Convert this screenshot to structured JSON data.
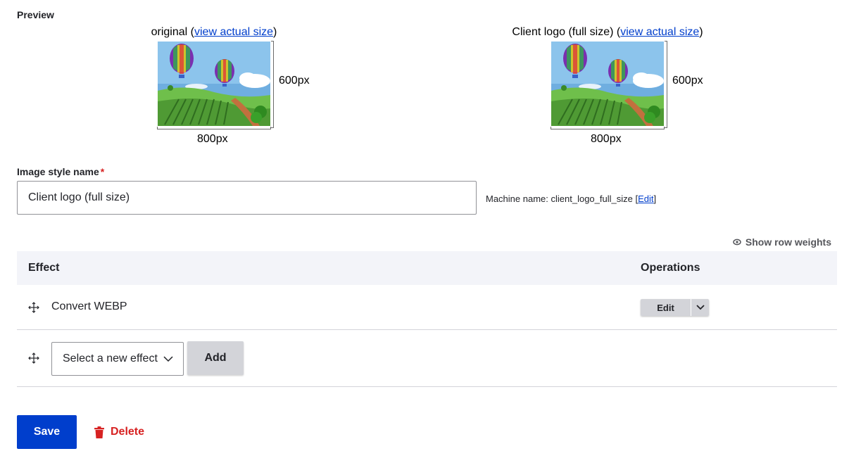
{
  "preview": {
    "section_label": "Preview",
    "original": {
      "caption": "original",
      "link": "view actual size",
      "height_label": "600px",
      "width_label": "800px"
    },
    "styled": {
      "caption": "Client logo (full size)",
      "link": "view actual size",
      "height_label": "600px",
      "width_label": "800px"
    }
  },
  "name_field": {
    "label": "Image style name",
    "required_marker": "*",
    "value": "Client logo (full size)",
    "machine_name_prefix": "Machine name: client_logo_full_size [",
    "machine_name_edit": "Edit",
    "machine_name_suffix": "]"
  },
  "effects": {
    "show_row_weights": "Show row weights",
    "headers": {
      "effect": "Effect",
      "operations": "Operations"
    },
    "rows": [
      {
        "name": "Convert WEBP",
        "edit_label": "Edit"
      }
    ],
    "new_effect": {
      "select_value": "Select a new effect",
      "add_label": "Add"
    }
  },
  "actions": {
    "save": "Save",
    "delete": "Delete"
  },
  "colors": {
    "primary": "#003ecc",
    "danger": "#d72222",
    "table_header_bg": "#f3f4f9"
  },
  "icons": [
    "eye-icon",
    "drag-handle-icon",
    "chevron-down-icon",
    "trash-icon"
  ]
}
